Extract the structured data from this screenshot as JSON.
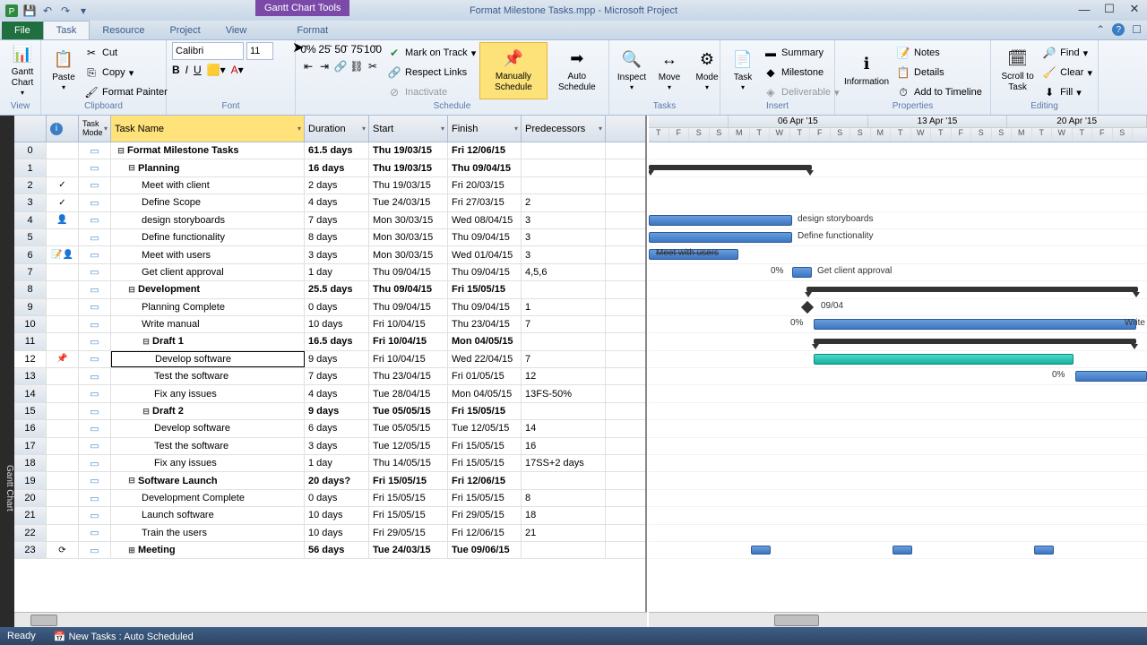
{
  "title_tool": "Gantt Chart Tools",
  "title": "Format Milestone Tasks.mpp - Microsoft Project",
  "tabs": {
    "file": "File",
    "task": "Task",
    "resource": "Resource",
    "project": "Project",
    "view": "View",
    "format": "Format"
  },
  "ribbon": {
    "view": {
      "gantt": "Gantt Chart",
      "label": "View"
    },
    "clipboard": {
      "paste": "Paste",
      "cut": "Cut",
      "copy": "Copy",
      "painter": "Format Painter",
      "label": "Clipboard"
    },
    "font": {
      "name": "Calibri",
      "size": "11",
      "label": "Font"
    },
    "schedule": {
      "mark": "Mark on Track",
      "respect": "Respect Links",
      "inactivate": "Inactivate",
      "manual": "Manually Schedule",
      "auto": "Auto Schedule",
      "label": "Schedule"
    },
    "tasks": {
      "inspect": "Inspect",
      "move": "Move",
      "mode": "Mode",
      "task": "Task",
      "summary": "Summary",
      "milestone": "Milestone",
      "deliverable": "Deliverable",
      "label": "Tasks"
    },
    "insert": {
      "label": "Insert"
    },
    "props": {
      "info": "Information",
      "notes": "Notes",
      "details": "Details",
      "timeline": "Add to Timeline",
      "label": "Properties"
    },
    "editing": {
      "scroll": "Scroll to Task",
      "find": "Find",
      "clear": "Clear",
      "fill": "Fill",
      "label": "Editing"
    }
  },
  "cols": {
    "info": "",
    "mode": "Task Mode",
    "name": "Task Name",
    "dur": "Duration",
    "start": "Start",
    "finish": "Finish",
    "pred": "Predecessors"
  },
  "weeks": [
    "06 Apr '15",
    "13 Apr '15",
    "20 Apr '15"
  ],
  "days": [
    "T",
    "F",
    "S",
    "S",
    "M",
    "T",
    "W",
    "T",
    "F",
    "S",
    "S",
    "M",
    "T",
    "W",
    "T",
    "F",
    "S",
    "S",
    "M",
    "T",
    "W",
    "T",
    "F",
    "S"
  ],
  "rows": [
    {
      "id": 0,
      "name": "Format Milestone Tasks",
      "dur": "61.5 days",
      "start": "Thu 19/03/15",
      "finish": "Fri 12/06/15",
      "pred": "",
      "bold": true,
      "indent": 0,
      "exp": true
    },
    {
      "id": 1,
      "name": "Planning",
      "dur": "16 days",
      "start": "Thu 19/03/15",
      "finish": "Thu 09/04/15",
      "pred": "",
      "bold": true,
      "indent": 1,
      "exp": true
    },
    {
      "id": 2,
      "name": "Meet with client",
      "dur": "2 days",
      "start": "Thu 19/03/15",
      "finish": "Fri 20/03/15",
      "pred": "",
      "indent": 2,
      "icon": "check"
    },
    {
      "id": 3,
      "name": "Define Scope",
      "dur": "4 days",
      "start": "Tue 24/03/15",
      "finish": "Fri 27/03/15",
      "pred": "2",
      "indent": 2,
      "icon": "check"
    },
    {
      "id": 4,
      "name": "design storyboards",
      "dur": "7 days",
      "start": "Mon 30/03/15",
      "finish": "Wed 08/04/15",
      "pred": "3",
      "indent": 2,
      "icon": "person"
    },
    {
      "id": 5,
      "name": "Define functionality",
      "dur": "8 days",
      "start": "Mon 30/03/15",
      "finish": "Thu 09/04/15",
      "pred": "3",
      "indent": 2
    },
    {
      "id": 6,
      "name": "Meet with users",
      "dur": "3 days",
      "start": "Mon 30/03/15",
      "finish": "Wed 01/04/15",
      "pred": "3",
      "indent": 2,
      "icon": "note-person"
    },
    {
      "id": 7,
      "name": "Get client approval",
      "dur": "1 day",
      "start": "Thu 09/04/15",
      "finish": "Thu 09/04/15",
      "pred": "4,5,6",
      "indent": 2
    },
    {
      "id": 8,
      "name": "Development",
      "dur": "25.5 days",
      "start": "Thu 09/04/15",
      "finish": "Fri 15/05/15",
      "pred": "",
      "bold": true,
      "indent": 1,
      "exp": true
    },
    {
      "id": 9,
      "name": "Planning Complete",
      "dur": "0 days",
      "start": "Thu 09/04/15",
      "finish": "Thu 09/04/15",
      "pred": "1",
      "indent": 2
    },
    {
      "id": 10,
      "name": "Write manual",
      "dur": "10 days",
      "start": "Fri 10/04/15",
      "finish": "Thu 23/04/15",
      "pred": "7",
      "indent": 2
    },
    {
      "id": 11,
      "name": "Draft 1",
      "dur": "16.5 days",
      "start": "Fri 10/04/15",
      "finish": "Mon 04/05/15",
      "pred": "",
      "bold": true,
      "indent": 2,
      "exp": true
    },
    {
      "id": 12,
      "name": "Develop software",
      "dur": "9 days",
      "start": "Fri 10/04/15",
      "finish": "Wed 22/04/15",
      "pred": "7",
      "indent": 3,
      "icon": "pin",
      "sel": true
    },
    {
      "id": 13,
      "name": "Test the software",
      "dur": "7 days",
      "start": "Thu 23/04/15",
      "finish": "Fri 01/05/15",
      "pred": "12",
      "indent": 3
    },
    {
      "id": 14,
      "name": "Fix any issues",
      "dur": "4 days",
      "start": "Tue 28/04/15",
      "finish": "Mon 04/05/15",
      "pred": "13FS-50%",
      "indent": 3
    },
    {
      "id": 15,
      "name": "Draft 2",
      "dur": "9 days",
      "start": "Tue 05/05/15",
      "finish": "Fri 15/05/15",
      "pred": "",
      "bold": true,
      "indent": 2,
      "exp": true
    },
    {
      "id": 16,
      "name": "Develop software",
      "dur": "6 days",
      "start": "Tue 05/05/15",
      "finish": "Tue 12/05/15",
      "pred": "14",
      "indent": 3
    },
    {
      "id": 17,
      "name": "Test the software",
      "dur": "3 days",
      "start": "Tue 12/05/15",
      "finish": "Fri 15/05/15",
      "pred": "16",
      "indent": 3
    },
    {
      "id": 18,
      "name": "Fix any issues",
      "dur": "1 day",
      "start": "Thu 14/05/15",
      "finish": "Fri 15/05/15",
      "pred": "17SS+2 days",
      "indent": 3
    },
    {
      "id": 19,
      "name": "Software Launch",
      "dur": "20 days?",
      "start": "Fri 15/05/15",
      "finish": "Fri 12/06/15",
      "pred": "",
      "bold": true,
      "indent": 1,
      "exp": true
    },
    {
      "id": 20,
      "name": "Development Complete",
      "dur": "0 days",
      "start": "Fri 15/05/15",
      "finish": "Fri 15/05/15",
      "pred": "8",
      "indent": 2
    },
    {
      "id": 21,
      "name": "Launch software",
      "dur": "10 days",
      "start": "Fri 15/05/15",
      "finish": "Fri 29/05/15",
      "pred": "18",
      "indent": 2
    },
    {
      "id": 22,
      "name": "Train the users",
      "dur": "10 days",
      "start": "Fri 29/05/15",
      "finish": "Fri 12/06/15",
      "pred": "21",
      "indent": 2
    },
    {
      "id": 23,
      "name": "Meeting",
      "dur": "56 days",
      "start": "Tue 24/03/15",
      "finish": "Tue 09/06/15",
      "pred": "",
      "bold": true,
      "indent": 1,
      "exp": false,
      "icon": "recur"
    }
  ],
  "gantt_labels": {
    "design": "design storyboards",
    "func": "Define functionality",
    "users": "Meet with users",
    "approval": "Get client approval",
    "date": "09/04",
    "write": "Write",
    "pct0": "0%"
  },
  "status": {
    "ready": "Ready",
    "newtasks": "New Tasks : Auto Scheduled"
  },
  "viewbar": "Gantt Chart"
}
